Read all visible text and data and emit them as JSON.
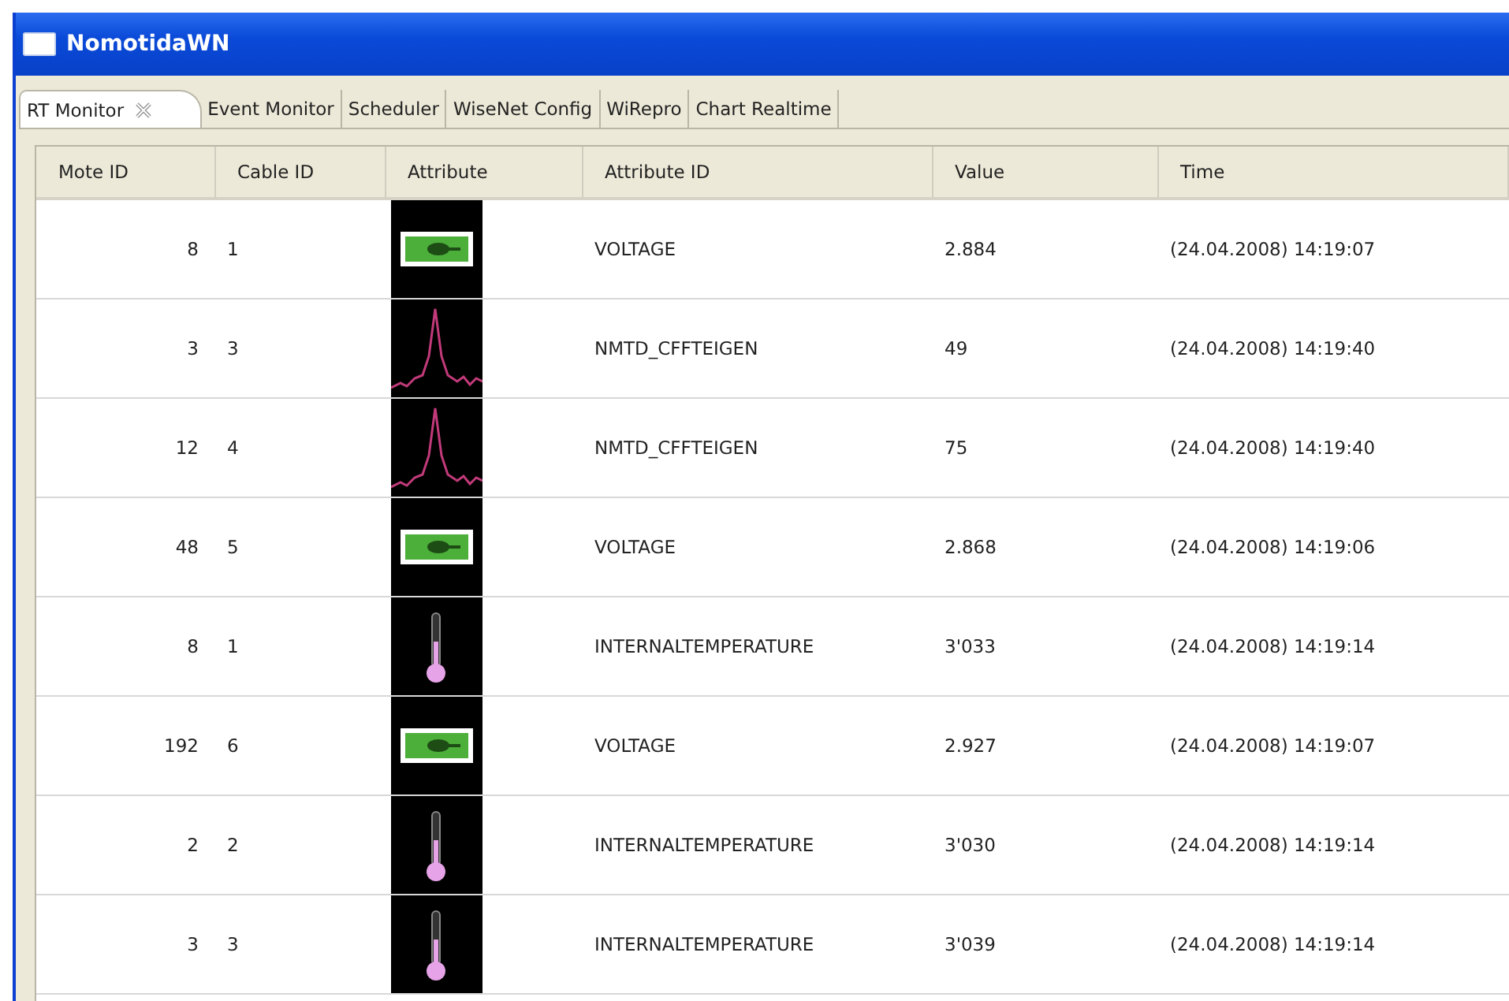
{
  "window": {
    "title": "NomotidaWN"
  },
  "tabs": [
    {
      "label": "RT Monitor",
      "selected": true,
      "closable": true
    },
    {
      "label": "Event Monitor",
      "selected": false,
      "closable": false
    },
    {
      "label": "Scheduler",
      "selected": false,
      "closable": false
    },
    {
      "label": "WiseNet Config",
      "selected": false,
      "closable": false
    },
    {
      "label": "WiRepro",
      "selected": false,
      "closable": false
    },
    {
      "label": "Chart Realtime",
      "selected": false,
      "closable": false
    }
  ],
  "table": {
    "columns": [
      "Mote ID",
      "Cable ID",
      "Attribute",
      "Attribute ID",
      "Value",
      "Time"
    ],
    "rows": [
      {
        "mote_id": "8",
        "cable_id": "1",
        "attribute": {
          "kind": "battery"
        },
        "attribute_id": "VOLTAGE",
        "value": "2.884",
        "time": "(24.04.2008) 14:19:07"
      },
      {
        "mote_id": "3",
        "cable_id": "3",
        "attribute": {
          "kind": "spectrum"
        },
        "attribute_id": "NMTD_CFFTEIGEN",
        "value": "49",
        "time": "(24.04.2008) 14:19:40"
      },
      {
        "mote_id": "12",
        "cable_id": "4",
        "attribute": {
          "kind": "spectrum"
        },
        "attribute_id": "NMTD_CFFTEIGEN",
        "value": "75",
        "time": "(24.04.2008) 14:19:40"
      },
      {
        "mote_id": "48",
        "cable_id": "5",
        "attribute": {
          "kind": "battery"
        },
        "attribute_id": "VOLTAGE",
        "value": "2.868",
        "time": "(24.04.2008) 14:19:06"
      },
      {
        "mote_id": "8",
        "cable_id": "1",
        "attribute": {
          "kind": "thermometer"
        },
        "attribute_id": "INTERNALTEMPERATURE",
        "value": "3'033",
        "time": "(24.04.2008) 14:19:14"
      },
      {
        "mote_id": "192",
        "cable_id": "6",
        "attribute": {
          "kind": "battery"
        },
        "attribute_id": "VOLTAGE",
        "value": "2.927",
        "time": "(24.04.2008) 14:19:07"
      },
      {
        "mote_id": "2",
        "cable_id": "2",
        "attribute": {
          "kind": "thermometer"
        },
        "attribute_id": "INTERNALTEMPERATURE",
        "value": "3'030",
        "time": "(24.04.2008) 14:19:14"
      },
      {
        "mote_id": "3",
        "cable_id": "3",
        "attribute": {
          "kind": "thermometer"
        },
        "attribute_id": "INTERNALTEMPERATURE",
        "value": "3'039",
        "time": "(24.04.2008) 14:19:14"
      }
    ]
  }
}
